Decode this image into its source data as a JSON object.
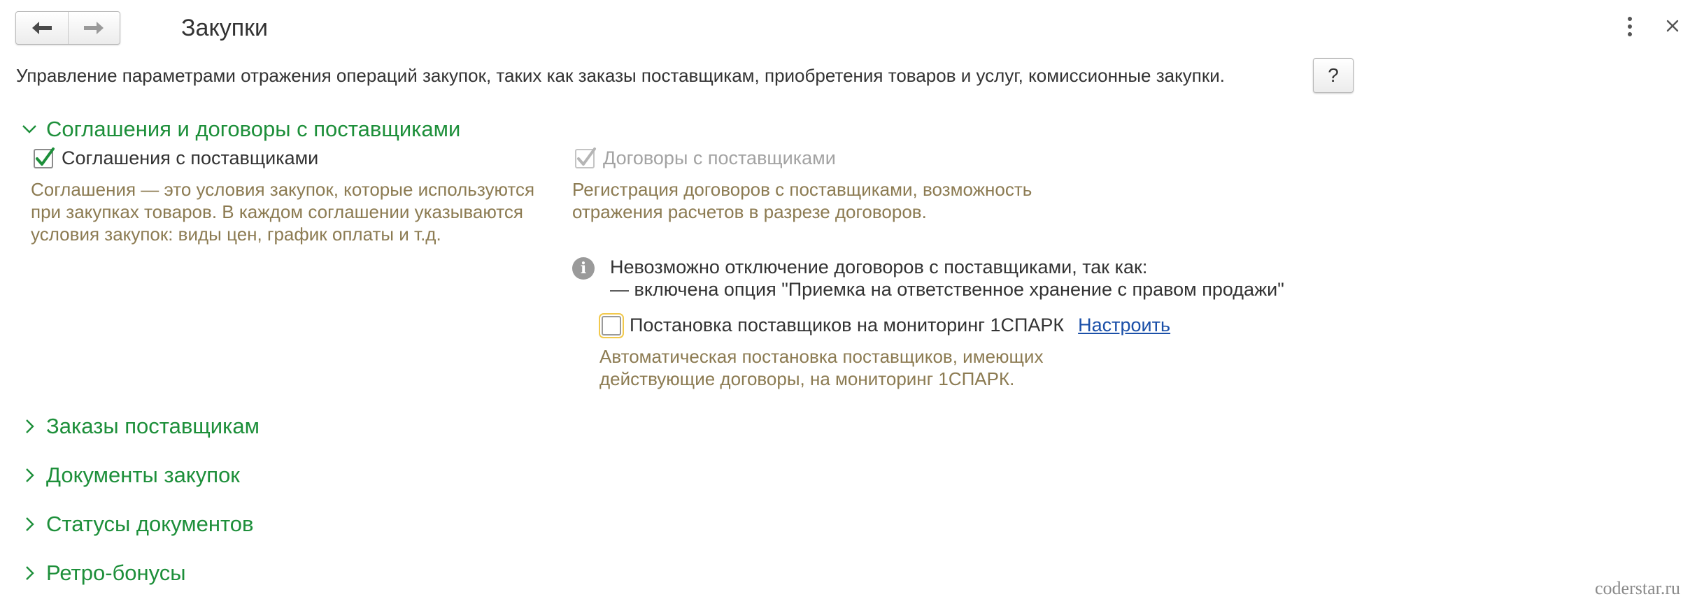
{
  "header": {
    "title": "Закупки",
    "back_icon": "arrow-left-icon",
    "forward_icon": "arrow-right-icon",
    "more_icon": "more-vertical-icon",
    "close_icon": "close-icon"
  },
  "description": "Управление параметрами отражения операций закупок, таких как заказы поставщикам, приобретения товаров и услуг, комиссионные закупки.",
  "help_label": "?",
  "sections": {
    "agreements": {
      "title": "Соглашения и договоры с поставщиками",
      "expanded": true,
      "agreements_checkbox": {
        "label": "Соглашения с поставщиками",
        "checked": true,
        "hint_lines": [
          "Соглашения — это условия закупок, которые используются",
          "при закупках товаров. В каждом соглашении указываются",
          "условия закупок: виды цен, график оплаты и т.д."
        ]
      },
      "contracts_checkbox": {
        "label": "Договоры с поставщиками",
        "checked": true,
        "disabled": true,
        "hint_lines": [
          "Регистрация договоров с поставщиками, возможность",
          "отражения расчетов в разрезе договоров."
        ]
      },
      "info": {
        "line1": "Невозможно отключение договоров с поставщиками, так как:",
        "line2": "— включена опция \"Приемка на ответственное хранение с правом продажи\""
      },
      "monitoring_checkbox": {
        "label": "Постановка поставщиков на мониторинг 1СПАРК",
        "checked": false,
        "link": "Настроить",
        "hint_lines": [
          "Автоматическая постановка поставщиков, имеющих",
          "действующие договоры, на мониторинг 1СПАРК."
        ]
      }
    },
    "orders": {
      "title": "Заказы поставщикам",
      "expanded": false
    },
    "documents": {
      "title": "Документы закупок",
      "expanded": false
    },
    "statuses": {
      "title": "Статусы документов",
      "expanded": false
    },
    "retro": {
      "title": "Ретро-бонусы",
      "expanded": false
    }
  },
  "watermark": "coderstar.ru",
  "colors": {
    "section_title": "#1d8f3a",
    "hint": "#8c7b52",
    "link": "#1a4fa8",
    "check": "#1d8f3a"
  }
}
